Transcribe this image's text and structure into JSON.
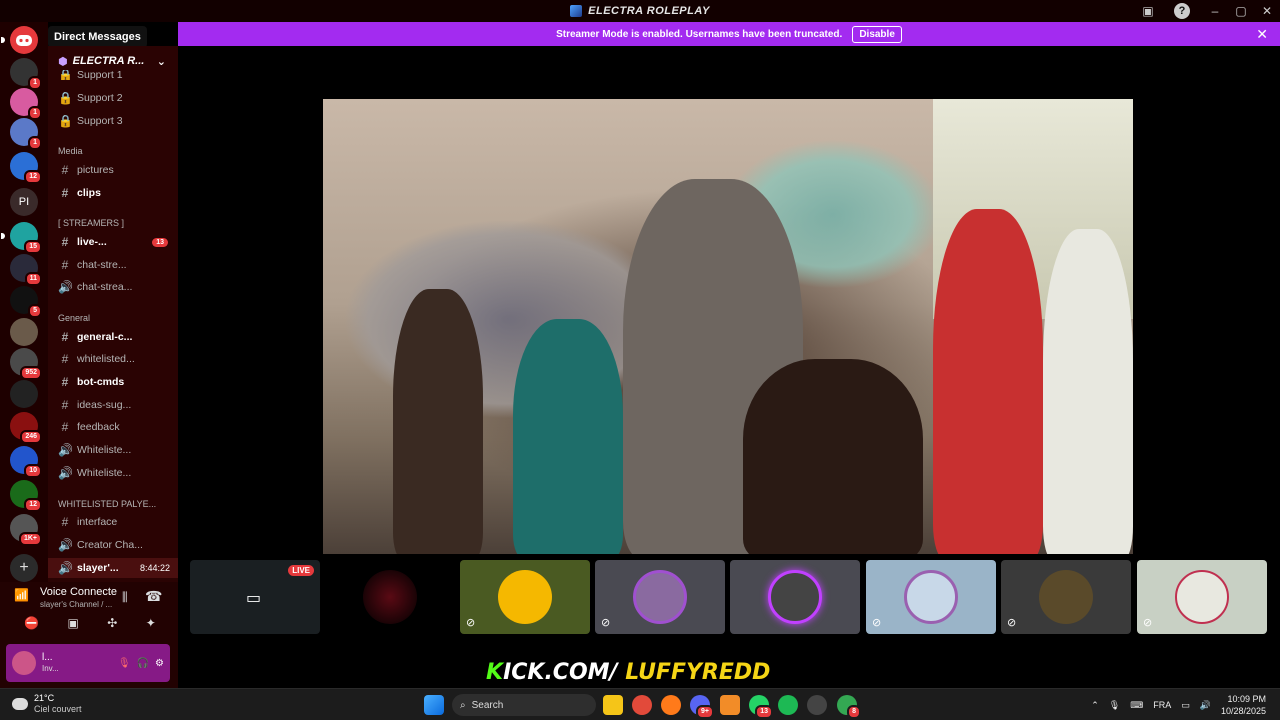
{
  "window": {
    "title": "ELECTRA ROLEPLAY",
    "controls": [
      "–",
      "▢",
      "✕"
    ]
  },
  "tooltip": "Direct Messages",
  "streamer_bar": {
    "message": "Streamer Mode is enabled. Usernames have been truncated.",
    "button": "Disable"
  },
  "servers": [
    {
      "badge": ""
    },
    {
      "badge": "1"
    },
    {
      "badge": "1"
    },
    {
      "badge": "1"
    },
    {
      "badge": "12"
    },
    {
      "label": "PI",
      "badge": ""
    },
    {
      "badge": "15"
    },
    {
      "badge": "11"
    },
    {
      "badge": "5"
    },
    {
      "badge": ""
    },
    {
      "badge": "952"
    },
    {
      "badge": ""
    },
    {
      "badge": "246"
    },
    {
      "badge": "10"
    },
    {
      "badge": "12"
    },
    {
      "badge": "1K+"
    }
  ],
  "server_name": "ELECTRA R...",
  "channels": {
    "support_cut": "Support 1",
    "support2": "Support 2",
    "support3": "Support 3",
    "cat_media": "Media",
    "pictures": "pictures",
    "clips": "clips",
    "cat_streamers": "[ STREAMERS ]",
    "live": "live-...",
    "live_badge": "13",
    "chat_stre1": "chat-stre...",
    "chat_strea2": "chat-strea...",
    "cat_general": "General",
    "general_c": "general-c...",
    "whitelisted": "whitelisted...",
    "bot_cmds": "bot-cmds",
    "ideas": "ideas-sug...",
    "feedback": "feedback",
    "whiteliste1": "Whiteliste...",
    "whiteliste2": "Whiteliste...",
    "cat_whitelisted": "WHITELISTED PALYE...",
    "interface": "interface",
    "creator": "Creator Cha...",
    "slayer": "slayer'...",
    "slayer_time": "8:44:22"
  },
  "voice": {
    "status": "Voice Connecte",
    "channel": "slayer's Channel / ...",
    "user_short": "l...",
    "user_sub": "Inv..."
  },
  "overlay": {
    "k": "K",
    "mid": "ICK.COM/",
    "user": "LUFFYREDD"
  },
  "tiles": [
    {
      "live": "LIVE"
    }
  ],
  "taskbar": {
    "temp": "21°C",
    "weather": "Ciel couvert",
    "search": "Search",
    "lang": "FRA",
    "time": "10:09 PM",
    "date": "10/28/2025",
    "badge_discord": "9+",
    "badge_whatsapp": "13",
    "badge_chrome": "8"
  },
  "colors": {
    "accent_purple": "#a32bf0",
    "badge_red": "#e5393c",
    "kick_green": "#53fc18",
    "kick_yellow": "#f5d516"
  }
}
